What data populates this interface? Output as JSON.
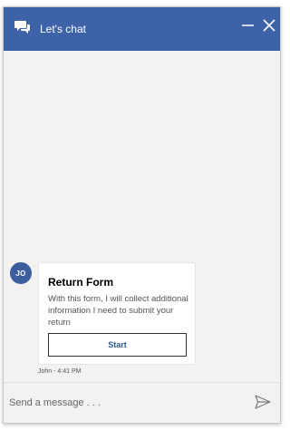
{
  "header": {
    "title": "Let's chat",
    "icon": "chat-bubbles-icon",
    "minimize_icon": "minimize-icon",
    "close_icon": "close-icon",
    "color": "#3d62a8"
  },
  "conversation": {
    "avatar_initials": "JO",
    "card": {
      "title": "Return Form",
      "body": "With this form, I will collect additional information I need to submit your return",
      "button_label": "Start"
    },
    "timestamp": "John - 4:41 PM"
  },
  "input": {
    "placeholder": "Send a message . . .",
    "value": "",
    "send_icon": "send-icon"
  }
}
